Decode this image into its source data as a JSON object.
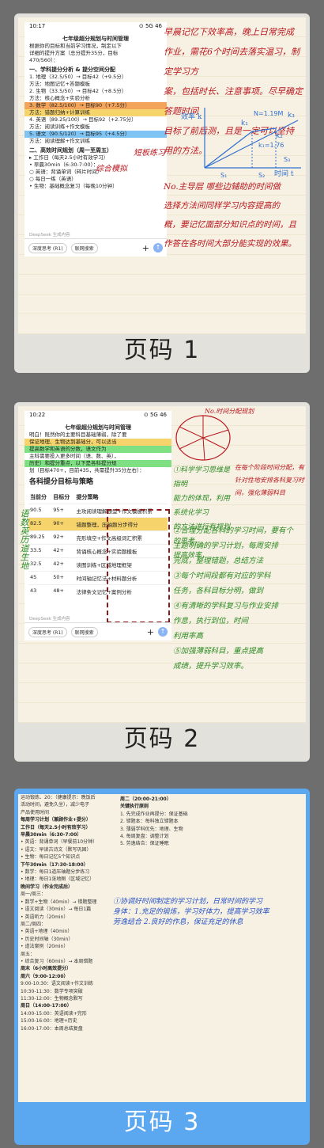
{
  "pages": [
    {
      "label": "页码 1",
      "phone": {
        "time": "10:17",
        "status_right": "⊙ 5G 46",
        "title": "七年级超分规划与时间管理",
        "lines": [
          "根据你的目标和当前学习情况，制定以下",
          "详细的提升方案（总分提升35分，目标",
          "470/560）：",
          "一、学科提分分析 & 提分空间分配",
          "1. 地理（32.5/50）→ 目标42（+9.5分）",
          "   方法：地图记忆+答题模板",
          "2. 生物（33.5/50）→ 目标42（+8.5分）",
          "   方法：核心概念+实验分析",
          "3. 数学（82.5/100）→ 目标90（+7.5分）",
          "   方法：错题归纳+计算训练",
          "4. 英语（89.25/100）→ 目标92（+2.75分）",
          "   方法：阅读训练+作文模板",
          "5. 语文（90.5/120）→ 目标95（+4.5分）",
          "   方法：阅读理解+作文训练",
          "二、高效时间规划（周一至周五）",
          "▸ 工作日（每天2.5小时有效学习）",
          "• 早晨30min（6:30-7:00）：",
          "   ○ 英语：背诵单词（碎片时间）",
          "   ○ 每日一练（英语）",
          "• 生物：基础概念复习（每晚10分钟）"
        ],
        "disclaimer": "DeepSeek 生成内容",
        "btn_think": "深度思考 (R1)",
        "btn_search": "联网搜索"
      },
      "hand_notes": [
        "早晨记忆下效率高，晚上日常完成",
        "作业，需花6个时间去落实温习，制定学习方",
        "案，包括时长、注意事项。尽早确定答题时间",
        "目标了前后测，且是一定可以坚持",
        "用的方法。",
        "No.主导层 哪些边辅助的时间做",
        "选择方法间同样学习内容提高的",
        "概，要记忆面部分知识点的时间，且",
        "作答在各时间大部分能实现的效果。"
      ],
      "chart_labels": {
        "x_label": "时间 t",
        "y_label": "效率 k",
        "k1": "k₁",
        "k2": "k₂",
        "k3": "k₃",
        "ann1": "N=1.19M",
        "ann2": "k₁=1.76",
        "s1": "S₁",
        "s2": "S₂",
        "s3": "S₃"
      },
      "side_marks": [
        "短板练习",
        "综合模拟"
      ]
    },
    {
      "label": "页码 2",
      "phone": {
        "time": "10:22",
        "status_right": "⊙ 5G 46",
        "title": "七年级超分规划与时间管理",
        "intro": [
          "明白！既然你的主要科目基础薄弱，除了要",
          "保证地理、生物达到基础分，可以适当",
          "提高数学和英语的分数，语文作为",
          "主科需要投入更多时间（语、数、英），",
          "历史）和提分重点，以下是各科提分规",
          "划（目标470+，目前435，共需提升35分左右）："
        ],
        "section": "各科提分目标与策略",
        "headers": [
          "当前分",
          "目标分",
          "提分策略"
        ],
        "rows": [
          [
            "90.5",
            "95+",
            "主攻阅读理解题型+作文模板积累"
          ],
          [
            "82.5",
            "90+",
            "错题整理，压轴题分步得分"
          ],
          [
            "89.25",
            "92+",
            "完形填空+作文高级词汇积累"
          ],
          [
            "33.5",
            "42+",
            "背诵核心概念+实验题模板"
          ],
          [
            "32.5",
            "42+",
            "读图训练+区域地理框架"
          ],
          [
            "45",
            "50+",
            "时间轴记忆法+材料题分析"
          ],
          [
            "43",
            "48+",
            "法律条文记忆+案例分析"
          ]
        ],
        "btn_think": "深度思考 (R1)",
        "btn_search": "联网搜索",
        "disclaimer": "DeepSeek 生成内容"
      },
      "left_margin_note": "语数英历道生地",
      "pie_caption": "No.时间分配规划",
      "hand_notes": [
        "①科学学习思维是指明",
        "能力的体现，利用系统化学习",
        "的方法进行有规划的思考，",
        "提高效率，",
        "②合理分配各科的学习时间，要有个",
        "主题明确的学习计划，每周安排",
        "完成，整理错题，总结方法",
        "③每个时间段都有对应的学科",
        "任务，各科目标分明，做到",
        "④有清晰的学科复习与作业安排",
        "作息，执行到位，时间",
        "利用率高",
        "⑤加强薄弱科目，重点提高",
        "成绩，提升学习效率。"
      ],
      "pie_right_note": "在每个阶段时间分配，有针对性地安排各科复习时间，强化薄弱科目"
    },
    {
      "label": "页码 3",
      "left_col": [
        "运动锻炼、20：（健康提示：晚饭后",
        "活动时间，避免久坐），减少电子",
        "产品使用时间",
        "每周学习计划（兼顾作业+提分）",
        "工作日（每天2.5小时有效学习）",
        "早晨30min（6:30-7:00）",
        "• 英语：背诵单词（早餐前10分钟）",
        "• 语文：早读古诗文（默写巩固）",
        "• 生物：每日记忆5个知识点",
        "下午30min（17:30-18:00）",
        "• 数学：每日1道压轴题分步练习",
        "• 地理：每日1张地图（区域记忆）",
        "晚间学习（作业完成后）",
        "周一/周三：",
        "• 数学+生物（40min）→ 错题整理",
        "• 语文阅读（30min）→ 每日1篇",
        "• 英语听力（20min）",
        "周二/周四：",
        "• 英语+地理（40min）",
        "• 历史时间轴（30min）",
        "• 道法案例（20min）",
        "周五：",
        "• 综合复习（60min）→ 本周错题",
        "周末（6小时高效提分）",
        "周六（9:00-12:00）",
        "9:00-10:30：语文阅读+作文训练",
        "10:30-11:30：数学专项突破",
        "11:30-12:00：生物概念默写",
        "周日（14:00-17:00）",
        "14:00-15:00：英语阅读+完形",
        "15:00-16:00：地理+历史",
        "16:00-17:00：本周总结复盘"
      ],
      "right_col": [
        "周二（20:00-21:00）",
        "关键执行原则",
        "1. 先完成作业再提分：保证基础",
        "2. 错题本：每科独立错题本",
        "3. 薄弱学科优先：地理、生物",
        "4. 每周复盘：调整计划",
        "5. 劳逸结合：保证睡眠"
      ],
      "hand_notes": [
        "①协调好时间制定的学习计划，日常时间的学习",
        "身体：1.充足的锻炼，学习好体力，提高学习效率",
        "劳逸结合  2.良好的作息，保证充足的休息"
      ]
    }
  ]
}
